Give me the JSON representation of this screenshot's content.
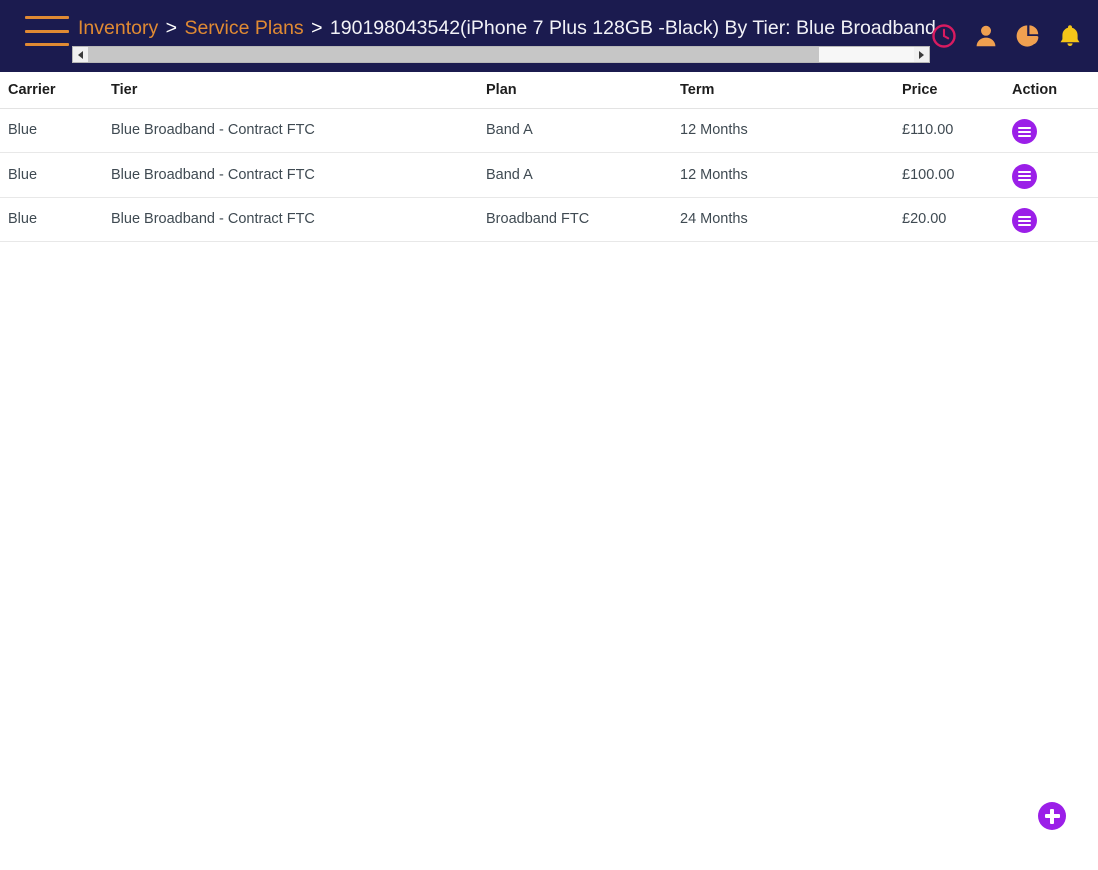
{
  "topbar": {
    "menu_icon": "hamburger-menu-icon",
    "breadcrumb": {
      "items": [
        {
          "label": "Inventory",
          "type": "link"
        },
        {
          "label": "Service Plans",
          "type": "link"
        },
        {
          "label": "190198043542(iPhone 7 Plus 128GB -Black) By Tier: Blue Broadband - Contract FTC",
          "type": "current"
        }
      ],
      "separator": ">"
    },
    "scrollbar": {
      "left_arrow": "◀",
      "right_arrow": "▶",
      "thumb_percent": 88.5
    },
    "icons": [
      {
        "name": "clock-icon",
        "color": "#d81b60"
      },
      {
        "name": "user-icon",
        "color": "#f0a050"
      },
      {
        "name": "pie-chart-icon",
        "color": "#f0a050"
      },
      {
        "name": "bell-icon",
        "color": "#f5c518"
      }
    ],
    "background_color": "#1b1b4f",
    "link_color": "#e08a33"
  },
  "table": {
    "columns": [
      {
        "key": "carrier",
        "label": "Carrier"
      },
      {
        "key": "tier",
        "label": "Tier"
      },
      {
        "key": "plan",
        "label": "Plan"
      },
      {
        "key": "term",
        "label": "Term"
      },
      {
        "key": "price",
        "label": "Price"
      },
      {
        "key": "action",
        "label": "Action"
      }
    ],
    "rows": [
      {
        "carrier": "Blue",
        "tier": "Blue Broadband - Contract FTC",
        "plan": "Band A",
        "term": "12 Months",
        "price": "£110.00",
        "action_icon": "row-menu-icon"
      },
      {
        "carrier": "Blue",
        "tier": "Blue Broadband - Contract FTC",
        "plan": "Band A",
        "term": "12 Months",
        "price": "£100.00",
        "action_icon": "row-menu-icon"
      },
      {
        "carrier": "Blue",
        "tier": "Blue Broadband - Contract FTC",
        "plan": "Broadband FTC",
        "term": "24 Months",
        "price": "£20.00",
        "action_icon": "row-menu-icon"
      }
    ]
  },
  "fab": {
    "name": "add-button",
    "icon": "plus-icon",
    "color": "#9b1fe8"
  }
}
